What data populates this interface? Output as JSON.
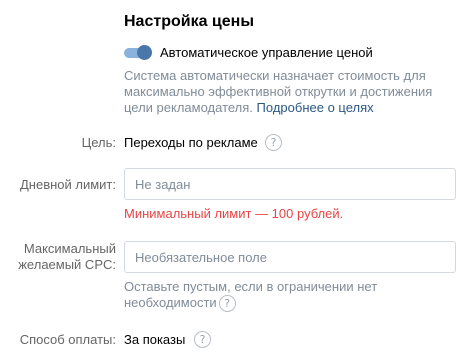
{
  "section": {
    "title": "Настройка цены"
  },
  "auto_price": {
    "toggle_on": true,
    "label": "Автоматическое управление ценой",
    "description_text": "Система автоматически назначает стоимость для максимально эффективной открутки и достижения цели рекламодателя. ",
    "description_link": "Подробнее о целях"
  },
  "goal": {
    "label": "Цель:",
    "value": "Переходы по рекламе",
    "help": "?"
  },
  "daily_limit": {
    "label": "Дневной лимит:",
    "value": "",
    "placeholder": "Не задан",
    "error": "Минимальный лимит — 100 рублей."
  },
  "max_cpc": {
    "label": "Максимальный желаемый CPC:",
    "value": "",
    "placeholder": "Необязательное поле",
    "hint": "Оставьте пустым, если в ограничении нет необходимости",
    "help": "?"
  },
  "payment_method": {
    "label": "Способ оплаты:",
    "value": "За показы",
    "help": "?"
  },
  "colors": {
    "accent": "#4a76a8",
    "link": "#2a5885",
    "error": "#e64646",
    "muted": "#818c99",
    "label": "#656565"
  }
}
